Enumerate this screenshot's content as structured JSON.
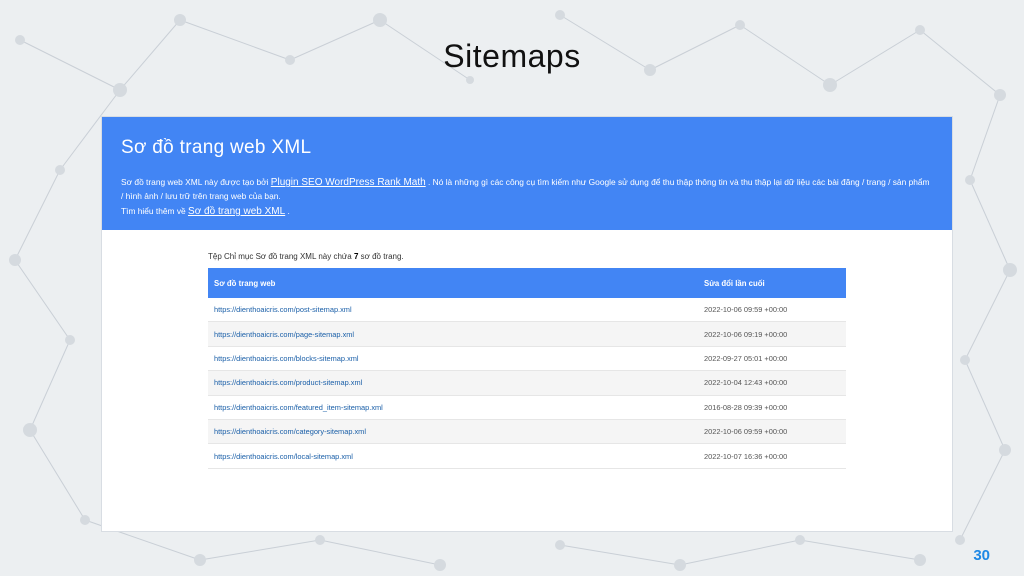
{
  "slide": {
    "title": "Sitemaps",
    "page_number": "30"
  },
  "theme": {
    "accent": "#4285f4",
    "page_number_color": "#1e88e5",
    "background": "#eceff1"
  },
  "sitemap_page": {
    "heading": "Sơ đồ trang web XML",
    "intro_part1": "Sơ đồ trang web XML này được tạo bởi ",
    "plugin_link": "Plugin SEO WordPress Rank Math",
    "intro_part2": " . Nó là những gì các công cụ tìm kiếm như Google sử dụng để thu thập thông tin và thu thập lại dữ liệu các bài đăng / trang / sản phẩm / hình ảnh / lưu trữ trên trang web của bạn.",
    "learn_more_prefix": "Tìm hiểu thêm về ",
    "learn_more_link": "Sơ đồ trang web XML",
    "learn_more_suffix": " .",
    "count_prefix": "Tệp Chỉ mục Sơ đồ trang XML này chứa ",
    "count": "7",
    "count_suffix": " sơ đồ trang.",
    "table": {
      "col_sitemap": "Sơ đồ trang web",
      "col_modified": "Sửa đổi lần cuối",
      "rows": [
        {
          "loc": "https://dienthoaicris.com/post-sitemap.xml",
          "lastmod": "2022-10-06 09:59 +00:00"
        },
        {
          "loc": "https://dienthoaicris.com/page-sitemap.xml",
          "lastmod": "2022-10-06 09:19 +00:00"
        },
        {
          "loc": "https://dienthoaicris.com/blocks-sitemap.xml",
          "lastmod": "2022-09-27 05:01 +00:00"
        },
        {
          "loc": "https://dienthoaicris.com/product-sitemap.xml",
          "lastmod": "2022-10-04 12:43 +00:00"
        },
        {
          "loc": "https://dienthoaicris.com/featured_item-sitemap.xml",
          "lastmod": "2016-08-28 09:39 +00:00"
        },
        {
          "loc": "https://dienthoaicris.com/category-sitemap.xml",
          "lastmod": "2022-10-06 09:59 +00:00"
        },
        {
          "loc": "https://dienthoaicris.com/local-sitemap.xml",
          "lastmod": "2022-10-07 16:36 +00:00"
        }
      ]
    }
  }
}
